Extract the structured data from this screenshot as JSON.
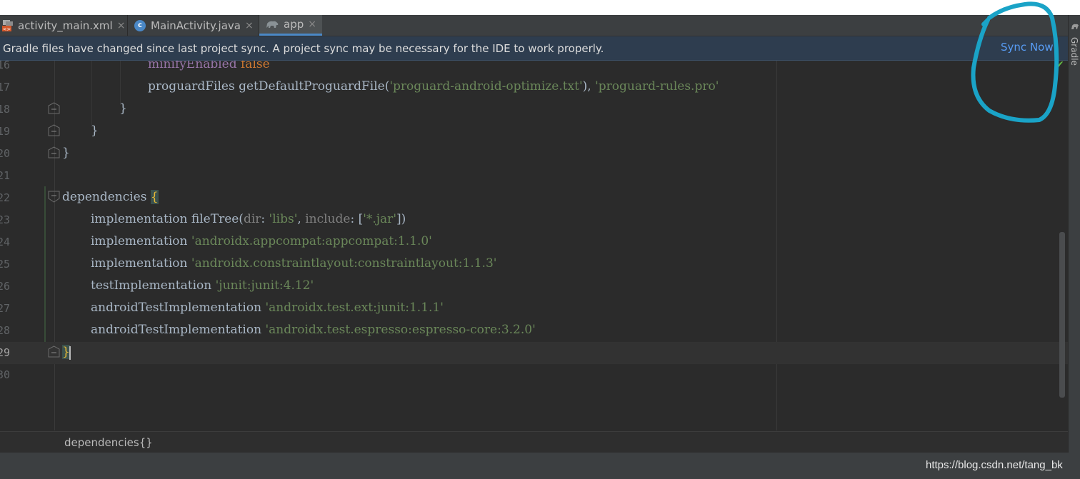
{
  "tabs": [
    {
      "label": "activity_main.xml",
      "close": "×",
      "icon": "xml-file-icon"
    },
    {
      "label": "MainActivity.java",
      "close": "×",
      "icon": "java-class-icon"
    },
    {
      "label": "app",
      "close": "×",
      "icon": "gradle-elephant-icon",
      "active": true
    }
  ],
  "banner": {
    "message": "Gradle files have changed since last project sync. A project sync may be necessary for the IDE to work properly.",
    "action": "Sync Now"
  },
  "editor": {
    "line_numbers": [
      "16",
      "17",
      "18",
      "19",
      "20",
      "21",
      "22",
      "23",
      "24",
      "25",
      "26",
      "27",
      "28",
      "29",
      "30"
    ],
    "current_line": "29",
    "lines": {
      "l16_a": "minifyEnabled",
      "l16_b": "false",
      "l17_a": "proguardFiles getDefaultProguardFile(",
      "l17_b": "'proguard-android-optimize.txt'",
      "l17_c": "), ",
      "l17_d": "'proguard-rules.pro'",
      "l18": "}",
      "l19": "}",
      "l20": "}",
      "l22_a": "dependencies ",
      "l22_b": "{",
      "l23_a": "implementation fileTree(",
      "l23_b": "dir",
      "l23_c": ": ",
      "l23_d": "'libs'",
      "l23_e": ", ",
      "l23_f": "include",
      "l23_g": ": [",
      "l23_h": "'*.jar'",
      "l23_i": "])",
      "l24_a": "implementation ",
      "l24_b": "'androidx.appcompat:appcompat:1.1.0'",
      "l25_a": "implementation ",
      "l25_b": "'androidx.constraintlayout:constraintlayout:1.1.3'",
      "l26_a": "testImplementation ",
      "l26_b": "'junit:junit:4.12'",
      "l27_a": "androidTestImplementation ",
      "l27_b": "'androidx.test.ext:junit:1.1.1'",
      "l28_a": "androidTestImplementation ",
      "l28_b": "'androidx.test.espresso:espresso-core:3.2.0'",
      "l29": "}"
    }
  },
  "breadcrumb": "dependencies{}",
  "side_tool": {
    "label": "Gradle"
  },
  "watermark": "https://blog.csdn.net/tang_bk",
  "colors": {
    "editor_bg": "#2b2b2b",
    "banner_bg": "#2e3d4f",
    "link": "#589df6",
    "keyword": "#cc7832",
    "string": "#6a8759",
    "annotation_circle": "#1aa3c7"
  }
}
